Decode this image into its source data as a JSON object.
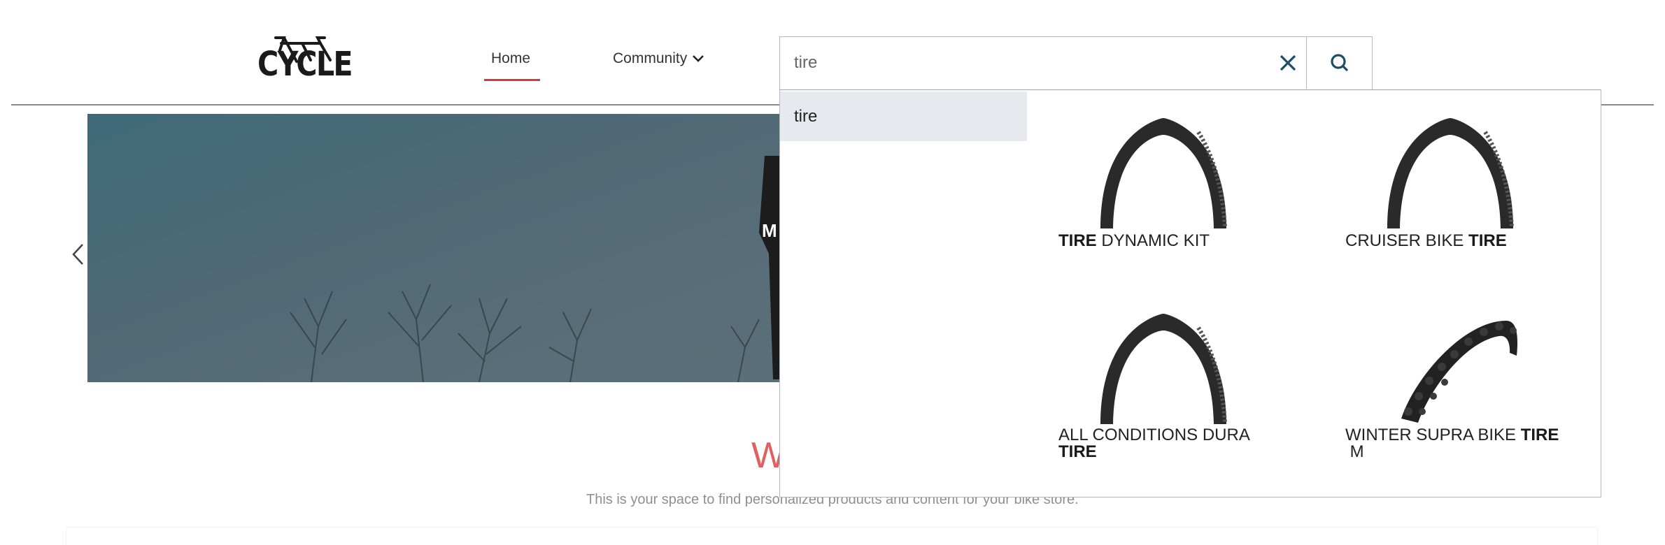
{
  "brand": {
    "logo_text": "CYCLE",
    "logo_icon": "bicycle-icon"
  },
  "nav": {
    "items": [
      {
        "label": "Home",
        "active": true
      },
      {
        "label": "Community",
        "has_dropdown": true,
        "icon": "chevron-down-icon"
      }
    ],
    "active_color": "#d9363e"
  },
  "search": {
    "value": "tire",
    "clear_icon": "close-icon",
    "submit_icon": "search-icon",
    "icon_color": "#1f4e63"
  },
  "autocomplete": {
    "suggestions": [
      {
        "label": "tire",
        "highlighted": true
      }
    ],
    "products": [
      {
        "name_parts": [
          {
            "text": "TIRE",
            "bold": true
          },
          {
            "text": " DYNAMIC KIT",
            "bold": false
          }
        ],
        "image": "road-tire"
      },
      {
        "name_parts": [
          {
            "text": "CRUISER BIKE ",
            "bold": false
          },
          {
            "text": "TIRE",
            "bold": true
          }
        ],
        "image": "road-tire"
      },
      {
        "name_parts": [
          {
            "text": "ALL CONDITIONS DURA ",
            "bold": false
          },
          {
            "text": "TIRE",
            "bold": true
          }
        ],
        "image": "road-tire"
      },
      {
        "name_parts": [
          {
            "text": "WINTER SUPRA BIKE ",
            "bold": false
          },
          {
            "text": "TIRE",
            "bold": true
          },
          {
            "text": " M",
            "bold": false
          }
        ],
        "image": "studded-tire"
      }
    ]
  },
  "hero": {
    "caption_partial": "M",
    "prev_icon": "chevron-left-icon"
  },
  "welcome": {
    "title_partial": "W",
    "subtitle": "This is your space to find personalized products and content for your bike store.",
    "title_color": "#e06060"
  }
}
